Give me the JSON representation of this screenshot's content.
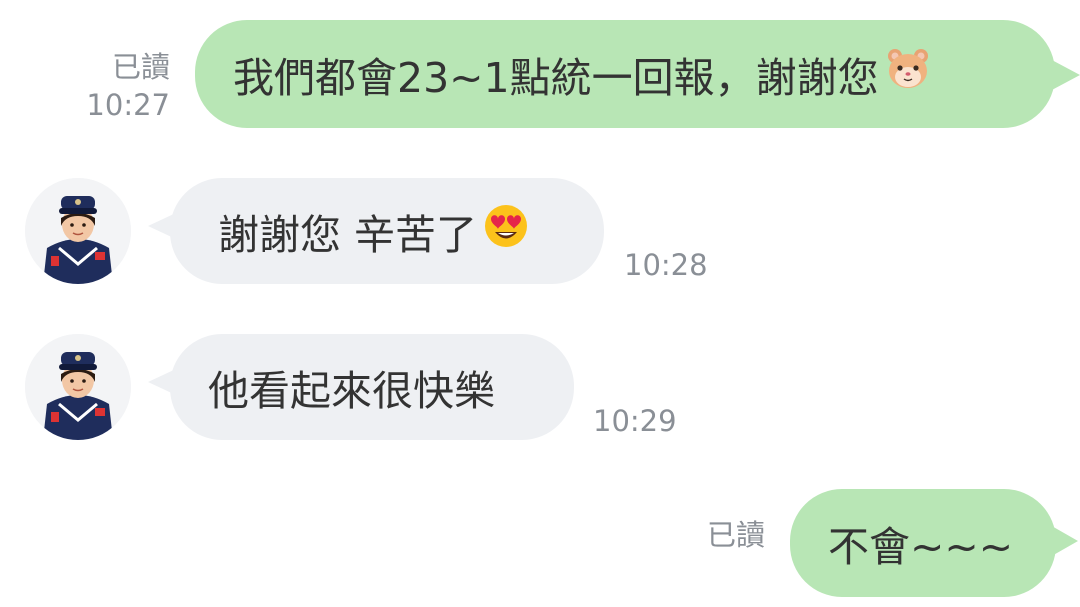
{
  "messages": [
    {
      "side": "out",
      "read_label": "已讀",
      "time": "10:27",
      "text": "我們都會23~1點統一回報，謝謝您",
      "emoji": "hamster-face"
    },
    {
      "side": "in",
      "time": "10:28",
      "text": "謝謝您 辛苦了",
      "emoji": "heart-eyes-face",
      "avatar": "police-officer-avatar"
    },
    {
      "side": "in",
      "time": "10:29",
      "text": "他看起來很快樂",
      "avatar": "police-officer-avatar"
    },
    {
      "side": "out",
      "read_label": "已讀",
      "text": "不會~~~"
    }
  ],
  "colors": {
    "outgoing_bubble": "#b8e6b5",
    "incoming_bubble": "#eef0f3",
    "meta_text": "#8a8f96",
    "message_text": "#333333"
  }
}
